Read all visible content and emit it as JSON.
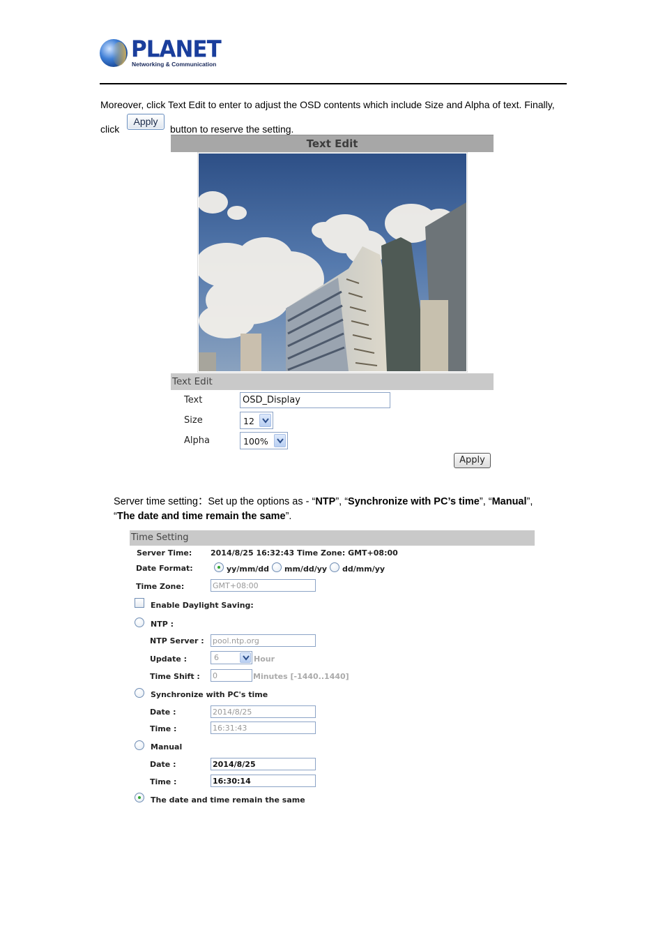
{
  "header": {
    "brand_name": "PLANET",
    "brand_tagline": "Networking & Communication"
  },
  "intro": {
    "line1": "Moreover, click Text Edit to enter to adjust the OSD contents which include Size and Alpha of text. Finally,",
    "line2_prefix": "click",
    "inline_button_label": "Apply",
    "line2_suffix": "button to reserve the setting."
  },
  "text_edit_panel": {
    "title": "Text Edit",
    "image_alt": "Camera view: blue sky with clouds and office buildings",
    "section_title": "Text Edit",
    "fields": {
      "text_label": "Text",
      "text_value": "OSD_Display",
      "size_label": "Size",
      "size_value": "12",
      "alpha_label": "Alpha",
      "alpha_value": "100%"
    },
    "apply_label": "Apply"
  },
  "server_time_intro": {
    "prefix": "Server time setting：Set up the options as - “",
    "opt1": "NTP",
    "sep1": "”, “",
    "opt2": "Synchronize with PC’s time",
    "sep2": "”, “",
    "opt3": "Manual",
    "sep3": "”,",
    "line2_open": "“",
    "opt4": "The date and time remain the same",
    "line2_close": "”."
  },
  "time_setting": {
    "title": "Time Setting",
    "server_time_label": "Server Time:",
    "server_time_value": "2014/8/25 16:32:43 Time Zone: GMT+08:00",
    "date_format_label": "Date Format:",
    "date_formats": [
      {
        "label": "yy/mm/dd",
        "checked": true
      },
      {
        "label": "mm/dd/yy",
        "checked": false
      },
      {
        "label": "dd/mm/yy",
        "checked": false
      }
    ],
    "time_zone_label": "Time Zone:",
    "time_zone_value": "GMT+08:00",
    "daylight_label": "Enable Daylight Saving:",
    "daylight_checked": false,
    "ntp": {
      "label": "NTP :",
      "checked": false,
      "server_label": "NTP Server :",
      "server_value": "pool.ntp.org",
      "update_label": "Update :",
      "update_value": "6",
      "update_unit": "Hour",
      "shift_label": "Time Shift :",
      "shift_value": "0",
      "shift_unit": "Minutes  [-1440..1440]"
    },
    "sync_pc": {
      "label": "Synchronize with PC's time",
      "checked": false,
      "date_label": "Date :",
      "date_value": "2014/8/25",
      "time_label": "Time :",
      "time_value": "16:31:43"
    },
    "manual": {
      "label": "Manual",
      "checked": false,
      "date_label": "Date :",
      "date_value": "2014/8/25",
      "time_label": "Time :",
      "time_value": "16:30:14"
    },
    "remain": {
      "label": "The date and time remain the same",
      "checked": true
    }
  }
}
